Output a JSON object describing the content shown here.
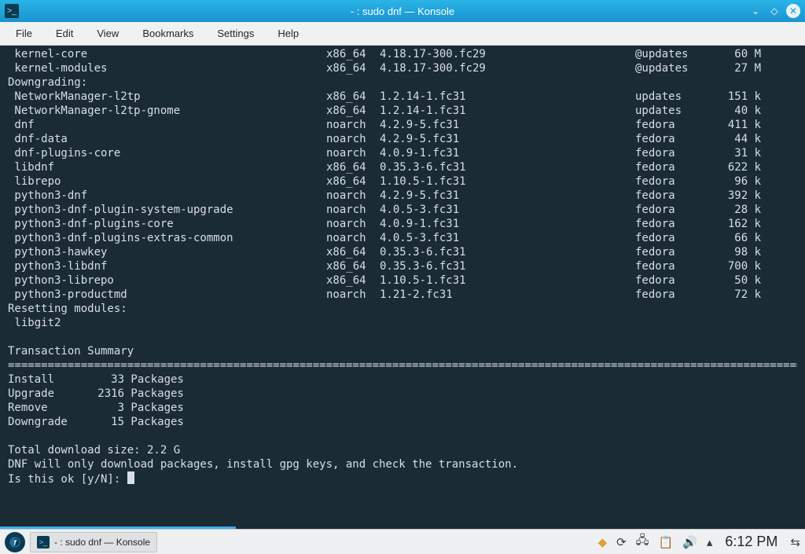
{
  "window": {
    "title": "- : sudo dnf — Konsole"
  },
  "menu": {
    "file": "File",
    "edit": "Edit",
    "view": "View",
    "bookmarks": "Bookmarks",
    "settings": "Settings",
    "help": "Help"
  },
  "terminal": {
    "pre_rows": [
      {
        "name": " kernel-core",
        "arch": "x86_64",
        "version": "4.18.17-300.fc29",
        "repo": "@updates",
        "size": "60 M"
      },
      {
        "name": " kernel-modules",
        "arch": "x86_64",
        "version": "4.18.17-300.fc29",
        "repo": "@updates",
        "size": "27 M"
      }
    ],
    "downgrading_label": "Downgrading:",
    "downgrade_rows": [
      {
        "name": " NetworkManager-l2tp",
        "arch": "x86_64",
        "version": "1.2.14-1.fc31",
        "repo": "updates",
        "size": "151 k"
      },
      {
        "name": " NetworkManager-l2tp-gnome",
        "arch": "x86_64",
        "version": "1.2.14-1.fc31",
        "repo": "updates",
        "size": "40 k"
      },
      {
        "name": " dnf",
        "arch": "noarch",
        "version": "4.2.9-5.fc31",
        "repo": "fedora",
        "size": "411 k"
      },
      {
        "name": " dnf-data",
        "arch": "noarch",
        "version": "4.2.9-5.fc31",
        "repo": "fedora",
        "size": "44 k"
      },
      {
        "name": " dnf-plugins-core",
        "arch": "noarch",
        "version": "4.0.9-1.fc31",
        "repo": "fedora",
        "size": "31 k"
      },
      {
        "name": " libdnf",
        "arch": "x86_64",
        "version": "0.35.3-6.fc31",
        "repo": "fedora",
        "size": "622 k"
      },
      {
        "name": " librepo",
        "arch": "x86_64",
        "version": "1.10.5-1.fc31",
        "repo": "fedora",
        "size": "96 k"
      },
      {
        "name": " python3-dnf",
        "arch": "noarch",
        "version": "4.2.9-5.fc31",
        "repo": "fedora",
        "size": "392 k"
      },
      {
        "name": " python3-dnf-plugin-system-upgrade",
        "arch": "noarch",
        "version": "4.0.5-3.fc31",
        "repo": "fedora",
        "size": "28 k"
      },
      {
        "name": " python3-dnf-plugins-core",
        "arch": "noarch",
        "version": "4.0.9-1.fc31",
        "repo": "fedora",
        "size": "162 k"
      },
      {
        "name": " python3-dnf-plugins-extras-common",
        "arch": "noarch",
        "version": "4.0.5-3.fc31",
        "repo": "fedora",
        "size": "66 k"
      },
      {
        "name": " python3-hawkey",
        "arch": "x86_64",
        "version": "0.35.3-6.fc31",
        "repo": "fedora",
        "size": "98 k"
      },
      {
        "name": " python3-libdnf",
        "arch": "x86_64",
        "version": "0.35.3-6.fc31",
        "repo": "fedora",
        "size": "700 k"
      },
      {
        "name": " python3-librepo",
        "arch": "x86_64",
        "version": "1.10.5-1.fc31",
        "repo": "fedora",
        "size": "50 k"
      },
      {
        "name": " python3-productmd",
        "arch": "noarch",
        "version": "1.21-2.fc31",
        "repo": "fedora",
        "size": "72 k"
      }
    ],
    "reset_label": "Resetting modules:",
    "reset_module": " libgit2",
    "summary_title": "Transaction Summary",
    "rule": "================================================================================================================================",
    "summary": [
      {
        "label": "Install",
        "count": "33",
        "unit": "Packages"
      },
      {
        "label": "Upgrade",
        "count": "2316",
        "unit": "Packages"
      },
      {
        "label": "Remove",
        "count": "3",
        "unit": "Packages"
      },
      {
        "label": "Downgrade",
        "count": "15",
        "unit": "Packages"
      }
    ],
    "total_size": "Total download size: 2.2 G",
    "info": "DNF will only download packages, install gpg keys, and check the transaction.",
    "prompt": "Is this ok [y/N]: "
  },
  "taskbar": {
    "entry_label": "- : sudo dnf — Konsole",
    "clock": "6:12 PM"
  }
}
